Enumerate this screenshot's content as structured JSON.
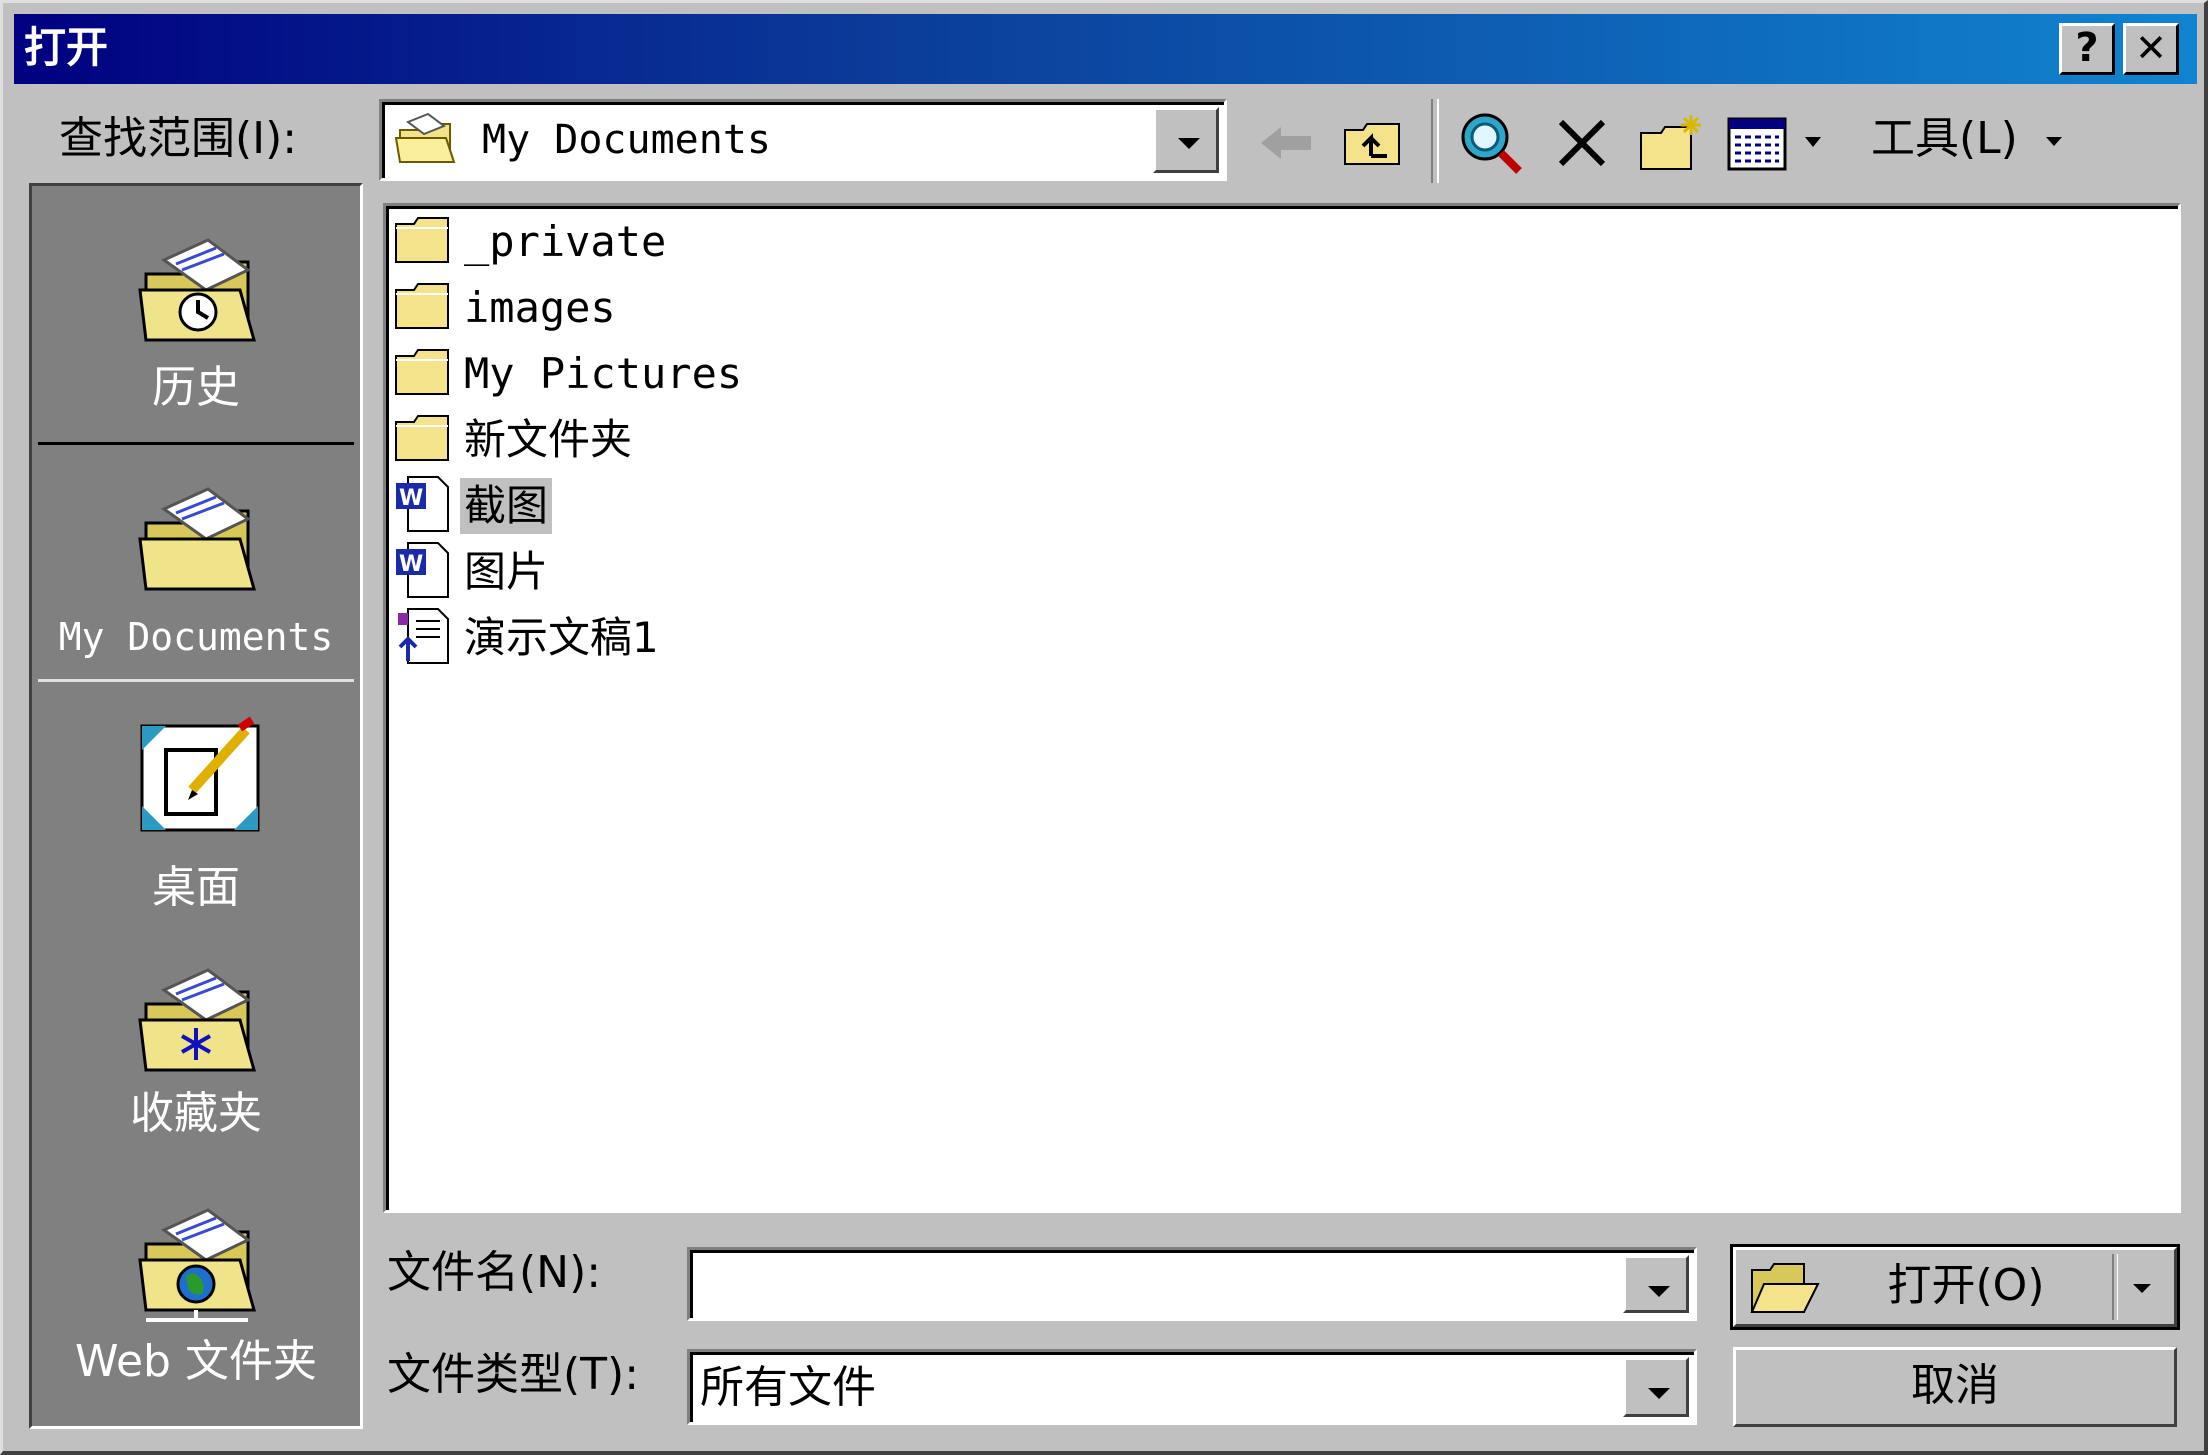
{
  "window": {
    "title": "打开"
  },
  "titlebar": {
    "help_label": "?",
    "close_label": "✕"
  },
  "lookin": {
    "label": "查找范围(I):",
    "value": "My Documents"
  },
  "toolbar": {
    "tools_label": "工具(L)",
    "icons": [
      "back-icon",
      "up-folder-icon",
      "search-web-icon",
      "delete-icon",
      "new-folder-icon",
      "views-icon"
    ]
  },
  "places": [
    {
      "label": "历史",
      "icon": "history-folder-icon"
    },
    {
      "label": "My Documents",
      "icon": "my-documents-folder-icon"
    },
    {
      "label": "桌面",
      "icon": "desktop-icon"
    },
    {
      "label": "收藏夹",
      "icon": "favorites-folder-icon"
    },
    {
      "label": "Web 文件夹",
      "icon": "web-folder-icon"
    }
  ],
  "files": [
    {
      "name": "_private",
      "type": "folder"
    },
    {
      "name": "images",
      "type": "folder"
    },
    {
      "name": "My Pictures",
      "type": "folder"
    },
    {
      "name": "新文件夹",
      "type": "folder"
    },
    {
      "name": "截图",
      "type": "word"
    },
    {
      "name": "图片",
      "type": "word"
    },
    {
      "name": "演示文稿1",
      "type": "ppt"
    }
  ],
  "filename": {
    "label": "文件名(N):",
    "value": ""
  },
  "filetype": {
    "label": "文件类型(T):",
    "value": "所有文件"
  },
  "buttons": {
    "open_label": "打开(O)",
    "cancel_label": "取消"
  }
}
